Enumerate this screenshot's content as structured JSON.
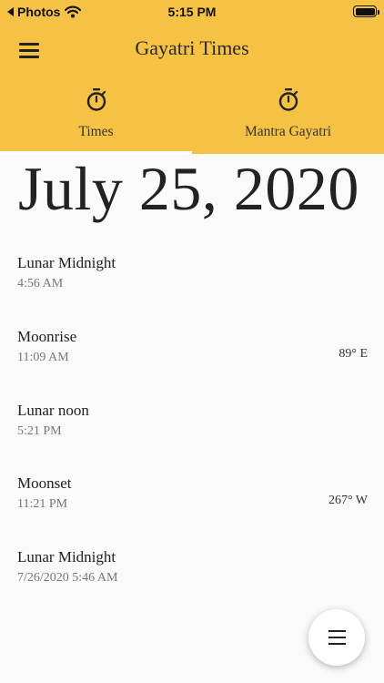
{
  "status_bar": {
    "back_label": "Photos",
    "time": "5:15 PM"
  },
  "app": {
    "title": "Gayatri Times"
  },
  "tabs": [
    {
      "label": "Times",
      "icon": "stopwatch-icon",
      "selected": true
    },
    {
      "label": "Mantra Gayatri",
      "icon": "stopwatch-icon",
      "selected": false
    }
  ],
  "date": "July 25, 2020",
  "events": [
    {
      "name": "Lunar Midnight",
      "time": "4:56 AM",
      "direction": ""
    },
    {
      "name": "Moonrise",
      "time": "11:09 AM",
      "direction": "89° E"
    },
    {
      "name": "Lunar noon",
      "time": "5:21 PM",
      "direction": ""
    },
    {
      "name": "Moonset",
      "time": "11:21 PM",
      "direction": "267° W"
    },
    {
      "name": "Lunar Midnight",
      "time": "7/26/2020 5:46 AM",
      "direction": ""
    }
  ],
  "colors": {
    "header_background": "#f6c244",
    "tab_indicator": "#ffffff",
    "page_background": "#fafafa"
  }
}
